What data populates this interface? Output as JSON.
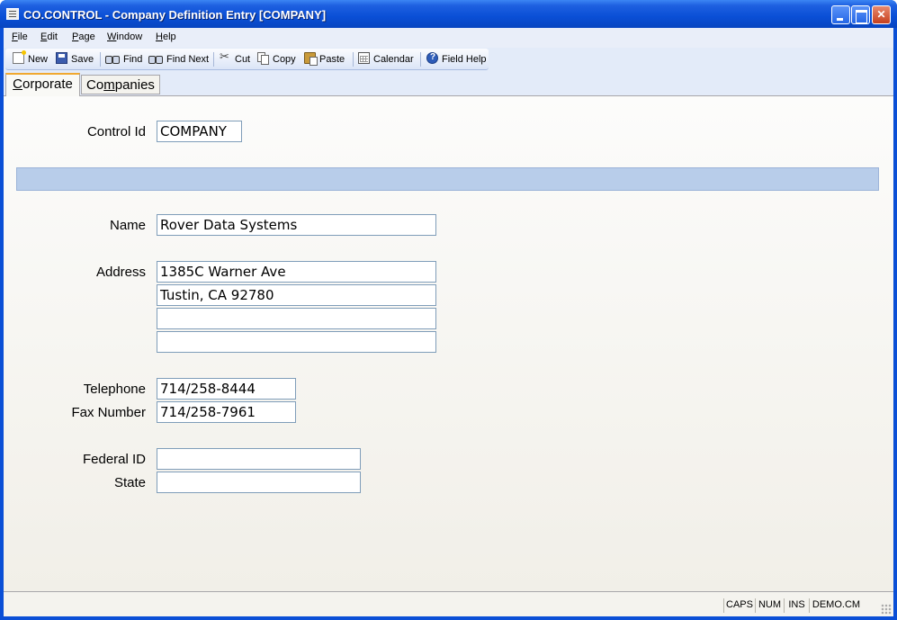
{
  "window": {
    "title": "CO.CONTROL - Company Definition Entry [COMPANY]"
  },
  "menu": [
    {
      "label": "File",
      "accel": "F",
      "rest": "ile"
    },
    {
      "label": "Edit",
      "accel": "E",
      "rest": "dit"
    },
    {
      "label": "Page",
      "accel": "P",
      "rest": "age"
    },
    {
      "label": "Window",
      "accel": "W",
      "rest": "indow"
    },
    {
      "label": "Help",
      "accel": "H",
      "rest": "elp"
    }
  ],
  "toolbar": {
    "new": "New",
    "save": "Save",
    "find": "Find",
    "find_next": "Find Next",
    "cut": "Cut",
    "copy": "Copy",
    "paste": "Paste",
    "calendar": "Calendar",
    "field_help": "Field Help"
  },
  "tabs": {
    "corporate": {
      "accel": "C",
      "rest": "orporate"
    },
    "companies": {
      "pre": "Co",
      "accel": "m",
      "rest": "panies"
    }
  },
  "form": {
    "control_id_label": "Control Id",
    "control_id": "COMPANY",
    "name_label": "Name",
    "name": "Rover Data Systems",
    "address_label": "Address",
    "address_1": "1385C Warner Ave",
    "address_2": "Tustin, CA 92780",
    "address_3": "",
    "address_4": "",
    "telephone_label": "Telephone",
    "telephone": "714/258-8444",
    "fax_label": "Fax Number",
    "fax": "714/258-7961",
    "federal_id_label": "Federal ID",
    "federal_id": "",
    "state_label": "State",
    "state": ""
  },
  "status": {
    "caps": "CAPS",
    "num": "NUM",
    "ins": "INS",
    "account": "DEMO.CM"
  }
}
